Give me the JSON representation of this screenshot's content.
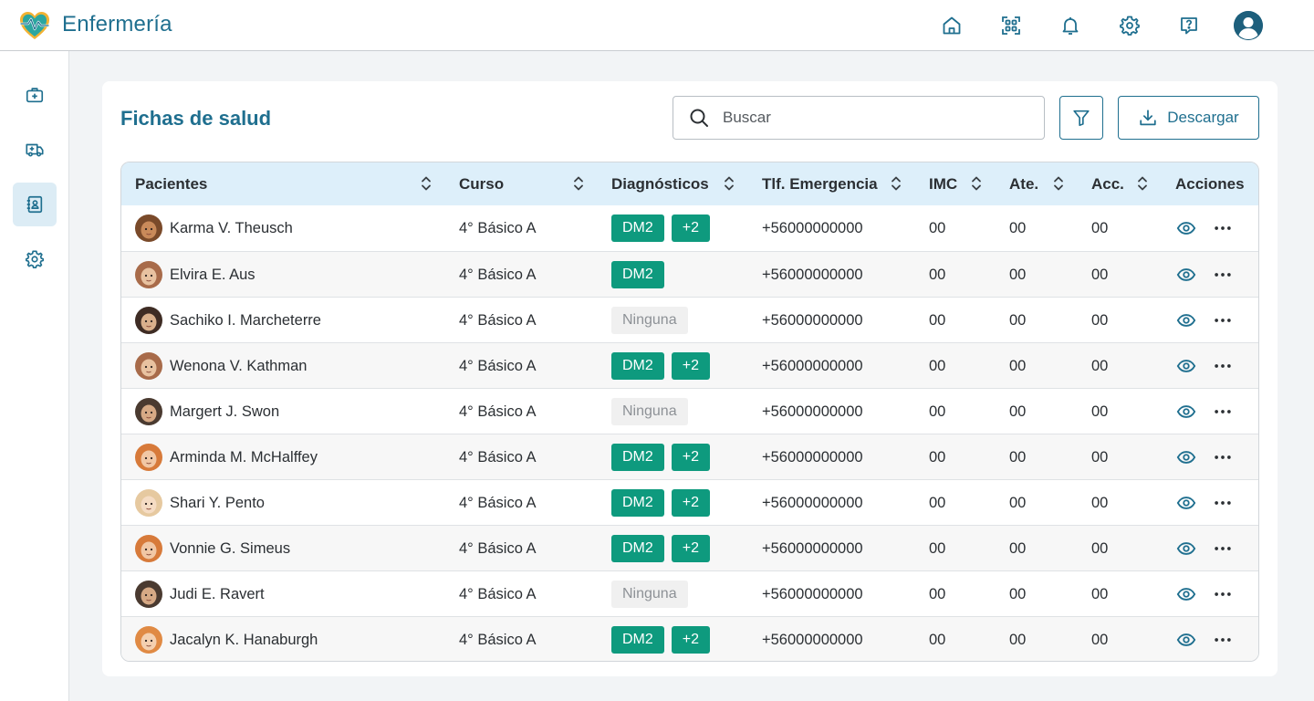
{
  "app": {
    "title": "Enfermería"
  },
  "header": {
    "icons": [
      "home-icon",
      "qr-scan-icon",
      "bell-icon",
      "gear-icon",
      "help-icon",
      "user-avatar"
    ]
  },
  "sidebar": {
    "items": [
      {
        "name": "first-aid-kit",
        "active": false
      },
      {
        "name": "ambulance",
        "active": false
      },
      {
        "name": "contact-book",
        "active": true
      },
      {
        "name": "settings",
        "active": false
      }
    ]
  },
  "page": {
    "title": "Fichas de salud",
    "search_placeholder": "Buscar",
    "download_label": "Descargar"
  },
  "table": {
    "columns": [
      "Pacientes",
      "Curso",
      "Diagnósticos",
      "Tlf. Emergencia",
      "IMC",
      "Ate.",
      "Acc.",
      "Acciones"
    ],
    "rows": [
      {
        "name": "Karma V. Theusch",
        "curso": "4° Básico A",
        "diag": [
          "DM2",
          "+2"
        ],
        "tel": "+56000000000",
        "imc": "00",
        "ate": "00",
        "acc": "00"
      },
      {
        "name": "Elvira E. Aus",
        "curso": "4° Básico A",
        "diag": [
          "DM2"
        ],
        "tel": "+56000000000",
        "imc": "00",
        "ate": "00",
        "acc": "00"
      },
      {
        "name": "Sachiko I. Marcheterre",
        "curso": "4° Básico A",
        "diag_none": "Ninguna",
        "tel": "+56000000000",
        "imc": "00",
        "ate": "00",
        "acc": "00"
      },
      {
        "name": "Wenona V. Kathman",
        "curso": "4° Básico A",
        "diag": [
          "DM2",
          "+2"
        ],
        "tel": "+56000000000",
        "imc": "00",
        "ate": "00",
        "acc": "00"
      },
      {
        "name": "Margert J. Swon",
        "curso": "4° Básico A",
        "diag_none": "Ninguna",
        "tel": "+56000000000",
        "imc": "00",
        "ate": "00",
        "acc": "00"
      },
      {
        "name": "Arminda M. McHalffey",
        "curso": "4° Básico A",
        "diag": [
          "DM2",
          "+2"
        ],
        "tel": "+56000000000",
        "imc": "00",
        "ate": "00",
        "acc": "00"
      },
      {
        "name": "Shari Y. Pento",
        "curso": "4° Básico A",
        "diag": [
          "DM2",
          "+2"
        ],
        "tel": "+56000000000",
        "imc": "00",
        "ate": "00",
        "acc": "00"
      },
      {
        "name": "Vonnie G. Simeus",
        "curso": "4° Básico A",
        "diag": [
          "DM2",
          "+2"
        ],
        "tel": "+56000000000",
        "imc": "00",
        "ate": "00",
        "acc": "00"
      },
      {
        "name": "Judi E. Ravert",
        "curso": "4° Básico A",
        "diag_none": "Ninguna",
        "tel": "+56000000000",
        "imc": "00",
        "ate": "00",
        "acc": "00"
      },
      {
        "name": "Jacalyn K. Hanaburgh",
        "curso": "4° Básico A",
        "diag": [
          "DM2",
          "+2"
        ],
        "tel": "+56000000000",
        "imc": "00",
        "ate": "00",
        "acc": "00"
      }
    ]
  },
  "colors": {
    "primary": "#1f6f8f",
    "badge": "#0e9a7e",
    "header_row": "#ddeffa",
    "active_nav": "#dcecf5"
  }
}
